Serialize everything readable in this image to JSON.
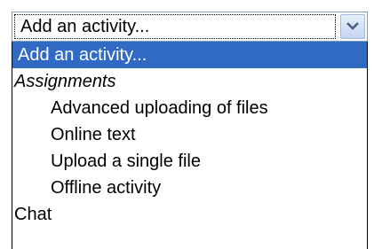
{
  "select": {
    "current_value": "Add an activity...",
    "arrow_icon": "chevron-down-icon",
    "accent_color": "#316ac5"
  },
  "dropdown": {
    "first_option": "Add an activity...",
    "group_label": "Assignments",
    "group_options": [
      "Advanced uploading of files",
      "Online text",
      "Upload a single file",
      "Offline activity"
    ],
    "last_option": "Chat"
  }
}
